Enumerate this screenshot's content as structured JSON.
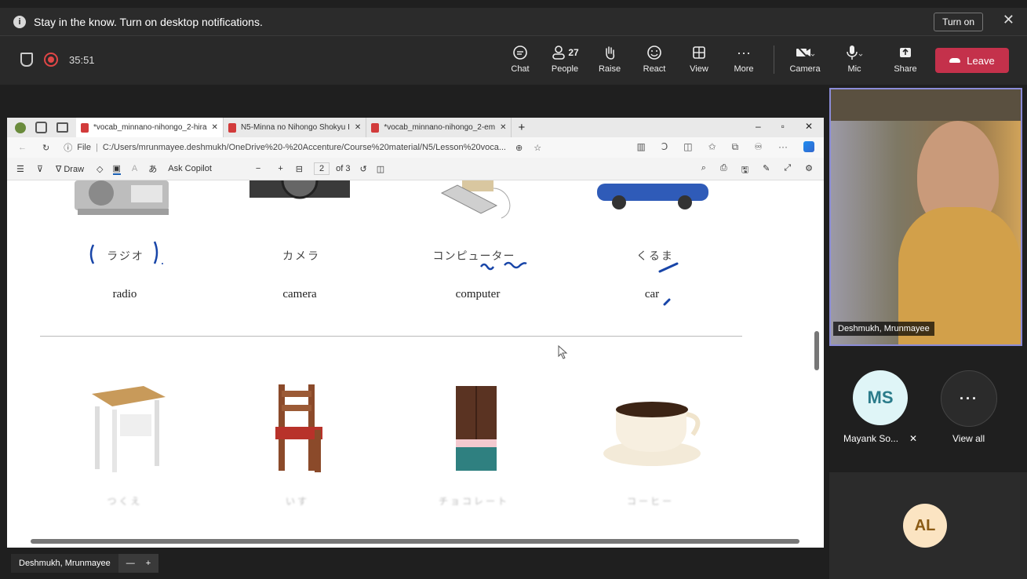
{
  "notification": {
    "message": "Stay in the know. Turn on desktop notifications.",
    "turn_on": "Turn on",
    "close": "✕"
  },
  "meeting": {
    "timer": "35:51",
    "buttons": [
      {
        "label": "Chat",
        "icon": "chat-icon"
      },
      {
        "label": "People",
        "icon": "people-icon",
        "badge": "27"
      },
      {
        "label": "Raise",
        "icon": "raise-hand-icon"
      },
      {
        "label": "React",
        "icon": "react-icon"
      },
      {
        "label": "View",
        "icon": "view-icon"
      },
      {
        "label": "More",
        "icon": "more-icon"
      },
      {
        "label": "Camera",
        "icon": "camera-off-icon"
      },
      {
        "label": "Mic",
        "icon": "mic-icon"
      },
      {
        "label": "Share",
        "icon": "share-icon"
      }
    ],
    "leave": "Leave"
  },
  "browser": {
    "tabs": [
      {
        "title": "*vocab_minnano-nihongo_2-hira"
      },
      {
        "title": "N5-Minna no Nihongo Shokyu I"
      },
      {
        "title": "*vocab_minnano-nihongo_2-em"
      }
    ],
    "address": {
      "prefix": "File",
      "url": "C:/Users/mrunmayee.deshmukh/OneDrive%20-%20Accenture/Course%20material/N5/Lesson%20voca..."
    },
    "pdf_toolbar": {
      "draw": "Draw",
      "kana": "あ",
      "ask": "Ask Copilot",
      "page": "2",
      "of": "of 3"
    }
  },
  "vocab_top": [
    {
      "jp": "ラジオ",
      "en": "radio"
    },
    {
      "jp": "カメラ",
      "en": "camera"
    },
    {
      "jp": "コンピューター",
      "en": "computer"
    },
    {
      "jp": "くるま",
      "en": "car"
    }
  ],
  "participants": {
    "presenter": "Deshmukh, Mrunmayee",
    "ms_initials": "MS",
    "ms_name": "Mayank So...",
    "view_all": "View all",
    "al_initials": "AL",
    "bottom_name": "Deshmukh, Mrunmayee"
  }
}
